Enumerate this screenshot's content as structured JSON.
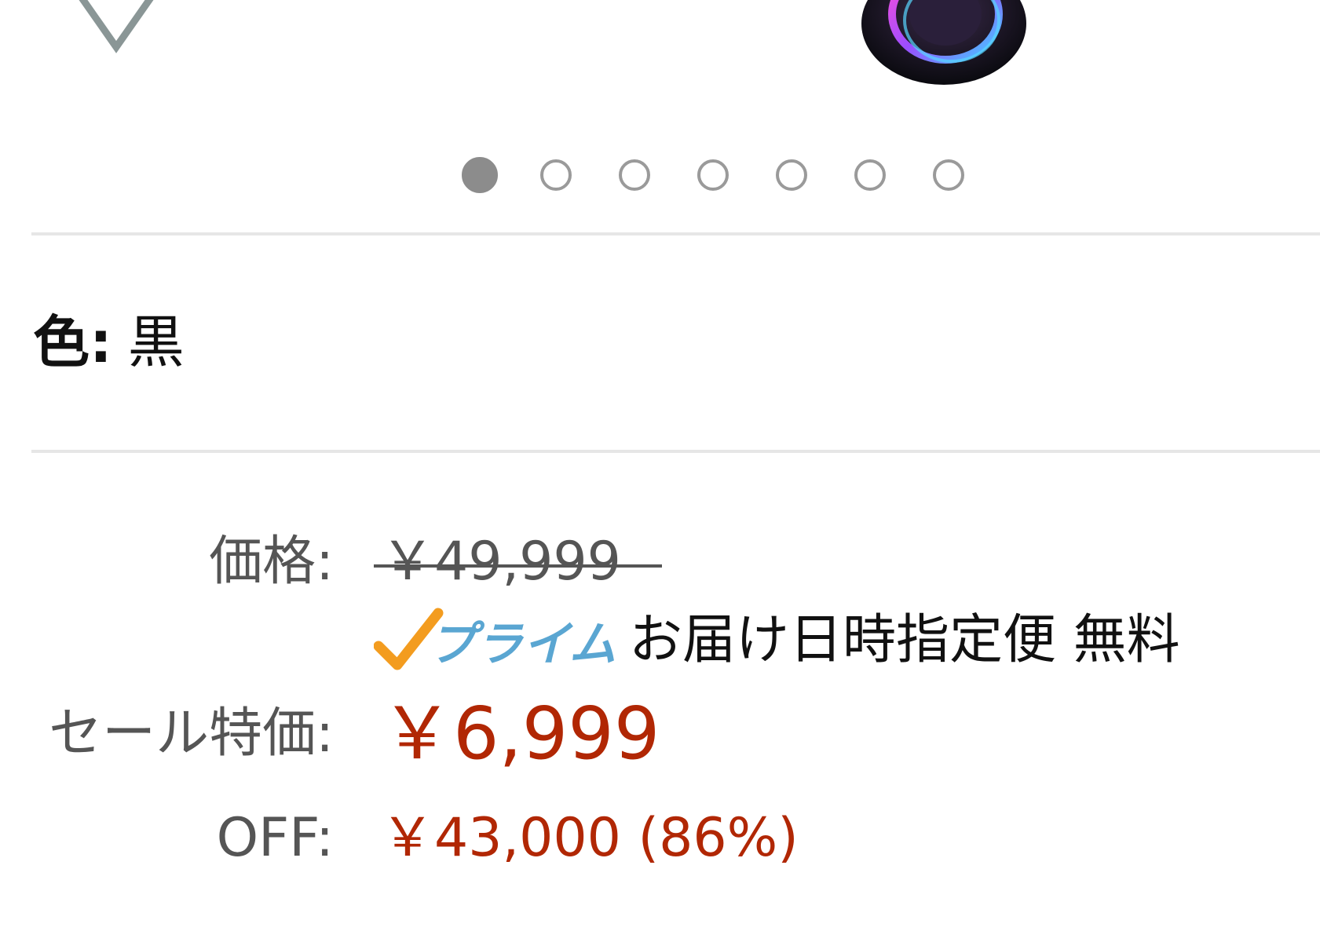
{
  "icons": {
    "wishlist": "heart-outline-icon",
    "prime": "prime-check-icon"
  },
  "carousel": {
    "total": 7,
    "active_index": 0
  },
  "product": {
    "color_label": "色:",
    "color_value": "黒"
  },
  "pricing": {
    "list_label": "価格:",
    "list_price": "￥49,999",
    "prime_logo_text": "プライム",
    "delivery_text": "お届け日時指定便 無料",
    "sale_label": "セール特価:",
    "sale_price": "￥6,999",
    "off_label": "OFF:",
    "off_value": "￥43,000 (86%)"
  },
  "colors": {
    "price_red": "#b12704",
    "label_gray": "#555555",
    "prime_blue": "#5aa6d2",
    "prime_orange": "#f39c1f"
  }
}
